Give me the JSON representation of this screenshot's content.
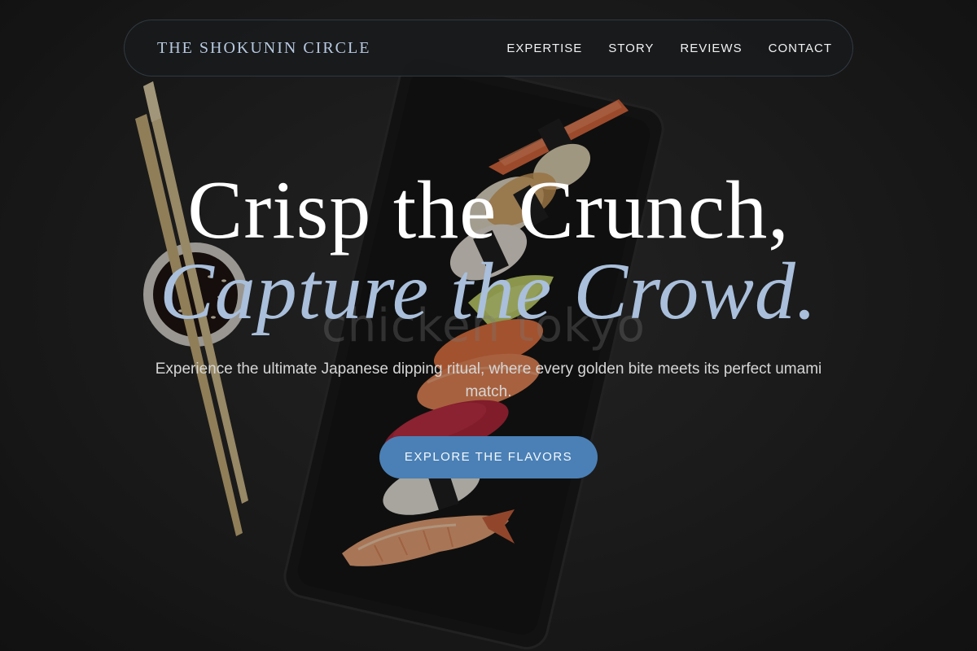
{
  "nav": {
    "brand": "THE SHOKUNIN CIRCLE",
    "links": [
      {
        "label": "EXPERTISE"
      },
      {
        "label": "STORY"
      },
      {
        "label": "REVIEWS"
      },
      {
        "label": "CONTACT"
      }
    ]
  },
  "hero": {
    "headline_line1": "Crisp the Crunch,",
    "headline_line2": "Capture the Crowd.",
    "subtitle": "Experience the ultimate Japanese dipping ritual, where every golden bite meets its perfect umami match.",
    "cta_label": "EXPLORE THE FLAVORS",
    "background_image": "sushi-platter-photo",
    "watermark_text": "chicken tokyo"
  },
  "colors": {
    "accent": "#4a80b6",
    "accent_text_light": "#a9bfdb",
    "background": "#1a1a1a"
  }
}
